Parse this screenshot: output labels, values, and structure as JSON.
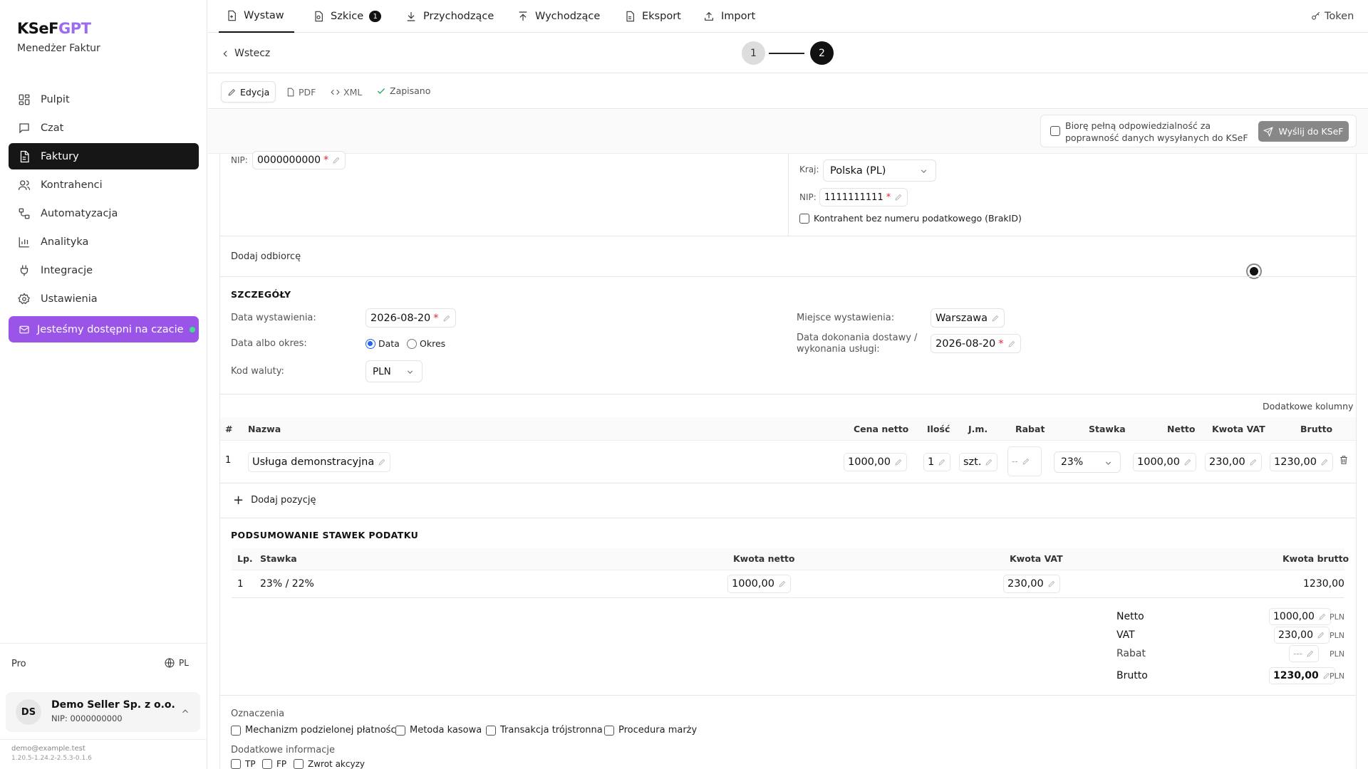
{
  "brand": {
    "name_a": "KSeF",
    "name_b": "GPT",
    "subtitle": "Menedżer Faktur"
  },
  "sidebar": {
    "items": [
      {
        "label": "Pulpit",
        "icon": "layout-grid-icon"
      },
      {
        "label": "Czat",
        "icon": "chat-icon"
      },
      {
        "label": "Faktury",
        "icon": "document-icon",
        "active": true
      },
      {
        "label": "Kontrahenci",
        "icon": "users-icon"
      },
      {
        "label": "Automatyzacja",
        "icon": "workflow-icon"
      },
      {
        "label": "Analityka",
        "icon": "chart-icon"
      },
      {
        "label": "Integracje",
        "icon": "plug-icon"
      },
      {
        "label": "Ustawienia",
        "icon": "gear-icon"
      }
    ],
    "promo": "Jesteśmy dostępni na czacie",
    "plan": "Pro",
    "lang": "PL",
    "user": {
      "initials": "DS",
      "name": "Demo Seller Sp. z o.o.",
      "nip": "NIP: 0000000000"
    },
    "email": "demo@example.test",
    "version": "1.20.5-1.24.2-2.5.3-0.1.6"
  },
  "topnav": {
    "tabs": [
      {
        "label": "Wystaw",
        "icon": "file-plus-icon",
        "active": true
      },
      {
        "label": "Szkice",
        "icon": "drafts-icon",
        "badge": "1"
      },
      {
        "label": "Przychodzące",
        "icon": "download-icon"
      },
      {
        "label": "Wychodzące",
        "icon": "upload-icon"
      },
      {
        "label": "Eksport",
        "icon": "file-export-icon"
      },
      {
        "label": "Import",
        "icon": "import-icon"
      }
    ],
    "token": "Token"
  },
  "toolbar": {
    "back": "Wstecz",
    "step1": "1",
    "step2": "2"
  },
  "modes": {
    "edit": "Edycja",
    "pdf": "PDF",
    "xml": "XML",
    "saved": "Zapisano"
  },
  "confirm": {
    "text": "Biorę pełną odpowiedzialność za poprawność danych wysyłanych do KSeF",
    "send": "Wyślij do KSeF"
  },
  "seller": {
    "nip_label": "NIP:",
    "nip": "0000000000"
  },
  "buyer": {
    "country_label": "Kraj:",
    "country": "Polska (PL)",
    "nip_label": "NIP:",
    "nip": "1111111111",
    "no_tax_id": "Kontrahent bez numeru podatkowego (BrakID)"
  },
  "add_recipient": "Dodaj odbiorcę",
  "details": {
    "title": "SZCZEGÓŁY",
    "issue_date_label": "Data wystawienia:",
    "issue_date": "2026-08-20",
    "date_or_period_label": "Data albo okres:",
    "radio_date": "Data",
    "radio_period": "Okres",
    "currency_label": "Kod waluty:",
    "currency": "PLN",
    "place_label": "Miejsce wystawienia:",
    "place": "Warszawa",
    "delivery_label_1": "Data dokonania dostawy /",
    "delivery_label_2": "wykonania usługi:",
    "delivery_date": "2026-08-20"
  },
  "items": {
    "extra_columns": "Dodatkowe kolumny",
    "headers": {
      "num": "#",
      "name": "Nazwa",
      "price": "Cena netto",
      "qty": "Ilość",
      "unit": "J.m.",
      "discount": "Rabat",
      "rate": "Stawka",
      "net": "Netto",
      "vat": "Kwota VAT",
      "gross": "Brutto"
    },
    "rows": [
      {
        "num": "1",
        "name": "Usługa demonstracyjna",
        "price": "1000,00",
        "qty": "1",
        "unit": "szt.",
        "discount": "--",
        "rate": "23%",
        "net": "1000,00",
        "vat": "230,00",
        "gross": "1230,00"
      }
    ],
    "add": "Dodaj pozycję"
  },
  "tax_summary": {
    "title": "PODSUMOWANIE STAWEK PODATKU",
    "headers": {
      "lp": "Lp.",
      "rate": "Stawka",
      "net": "Kwota netto",
      "vat": "Kwota VAT",
      "gross": "Kwota brutto"
    },
    "rows": [
      {
        "lp": "1",
        "rate": "23% / 22%",
        "net": "1000,00",
        "vat": "230,00",
        "gross": "1230,00"
      }
    ]
  },
  "totals": {
    "net_label": "Netto",
    "net": "1000,00",
    "vat_label": "VAT",
    "vat": "230,00",
    "discount_label": "Rabat",
    "discount": "---",
    "gross_label": "Brutto",
    "gross": "1230,00",
    "currency": "PLN"
  },
  "markings": {
    "title": "Oznaczenia",
    "options": [
      "Mechanizm podzielonej płatności",
      "Metoda kasowa",
      "Transakcja trójstronna",
      "Procedura marży"
    ],
    "extra_title": "Dodatkowe informacje",
    "extra_options": [
      "TP",
      "FP",
      "Zwrot akcyzy"
    ]
  }
}
